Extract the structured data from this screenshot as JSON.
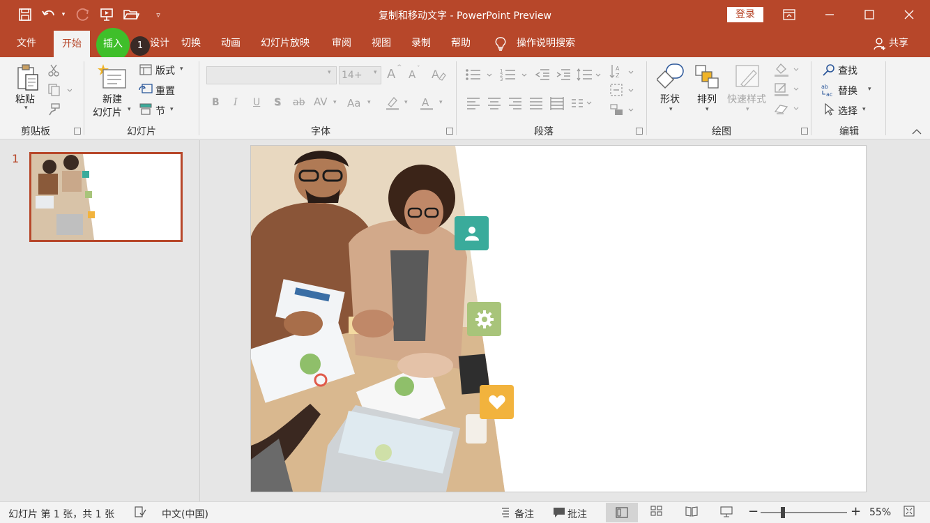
{
  "window": {
    "title": "复制和移动文字  -  PowerPoint Preview",
    "login_label": "登录"
  },
  "tabs": {
    "file": "文件",
    "home": "开始",
    "insert": "插入",
    "insert_badge": "1",
    "design": "设计",
    "transitions": "切换",
    "animations": "动画",
    "slideshow": "幻灯片放映",
    "review": "审阅",
    "view": "视图",
    "record": "录制",
    "help": "帮助",
    "tell_me": "操作说明搜索",
    "share": "共享"
  },
  "ribbon": {
    "clipboard": {
      "paste": "粘贴",
      "group": "剪贴板"
    },
    "slides": {
      "new_slide_line1": "新建",
      "new_slide_line2": "幻灯片",
      "layout": "版式",
      "reset": "重置",
      "section": "节",
      "group": "幻灯片"
    },
    "font": {
      "size_value": "14+",
      "bold": "B",
      "italic": "I",
      "underline": "U",
      "shadow": "S",
      "strike": "ab",
      "spacing": "AV",
      "case": "Aa",
      "grow": "A",
      "shrink": "A",
      "group": "字体"
    },
    "paragraph": {
      "group": "段落"
    },
    "drawing": {
      "shapes": "形状",
      "arrange": "排列",
      "quick_styles": "快速样式",
      "group": "绘图"
    },
    "editing": {
      "find": "查找",
      "replace": "替换",
      "select": "选择",
      "group": "编辑"
    }
  },
  "thumbnails": {
    "slide_number": "1"
  },
  "status": {
    "slide_info": "幻灯片 第 1 张，共 1 张",
    "language": "中文(中国)",
    "notes": "备注",
    "comments": "批注",
    "zoom": "55%",
    "zoom_level": 0.55
  },
  "colors": {
    "accent": "#b7472a",
    "tile_person": "#3aab9b",
    "tile_gear": "#a8c47a",
    "tile_heart": "#f2b33d",
    "insert_highlight": "#3fbf2a"
  }
}
